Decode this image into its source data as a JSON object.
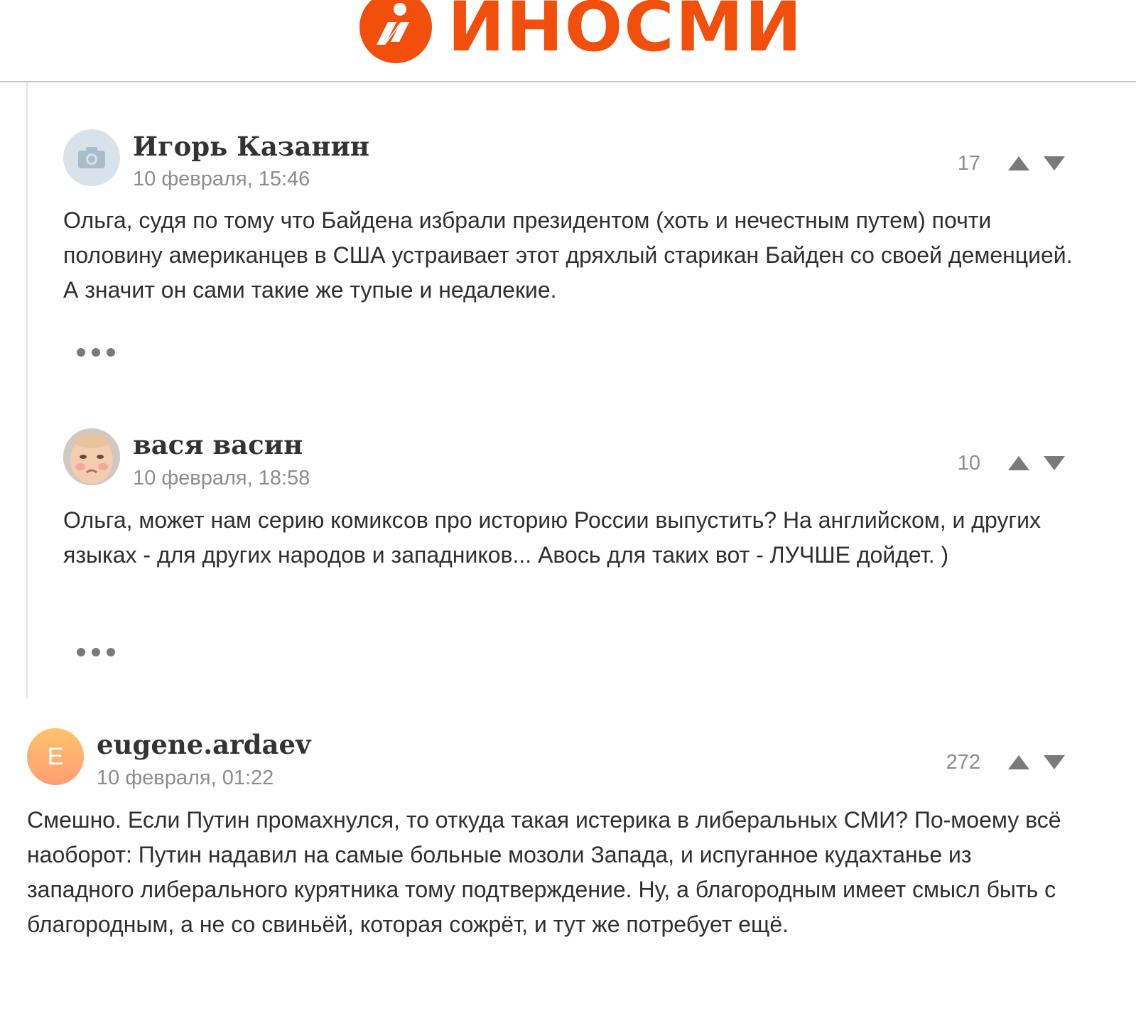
{
  "header": {
    "logo_text": "ИНОСМИ",
    "brand_color": "#f24e0c"
  },
  "comments": [
    {
      "author": "Игорь Казанин",
      "date": "10 февраля, 15:46",
      "votes": "17",
      "avatar": "camera-icon",
      "text": "Ольга, судя по тому что Байдена избрали президентом (хоть и нечестным путем) почти половину американцев в США устраивает этот дряхлый старикан Байден со своей деменцией. А значит он сами такие же тупые и недалекие."
    },
    {
      "author": "вася васин",
      "date": "10 февраля, 18:58",
      "votes": "10",
      "avatar": "baby-photo",
      "text": "Ольга, может нам серию комиксов про историю России выпустить? На английском, и других языках - для других народов и западников... Авось для таких вот - ЛУЧШЕ дойдет. )"
    },
    {
      "author": "eugene.ardaev",
      "date": "10 февраля, 01:22",
      "votes": "272",
      "avatar": "letter",
      "avatar_letter": "E",
      "text": "Смешно. Если Путин промахнулся, то откуда такая истерика в либеральных СМИ? По-моему всё наоборот: Путин надавил на самые больные мозоли Запада, и испуганное кудахтанье из западного либерального курятника тому подтверждение. Ну, а благородным имеет смысл быть с благородным, а не со свиньёй, которая сожрёт, и тут же потребует ещё."
    }
  ]
}
